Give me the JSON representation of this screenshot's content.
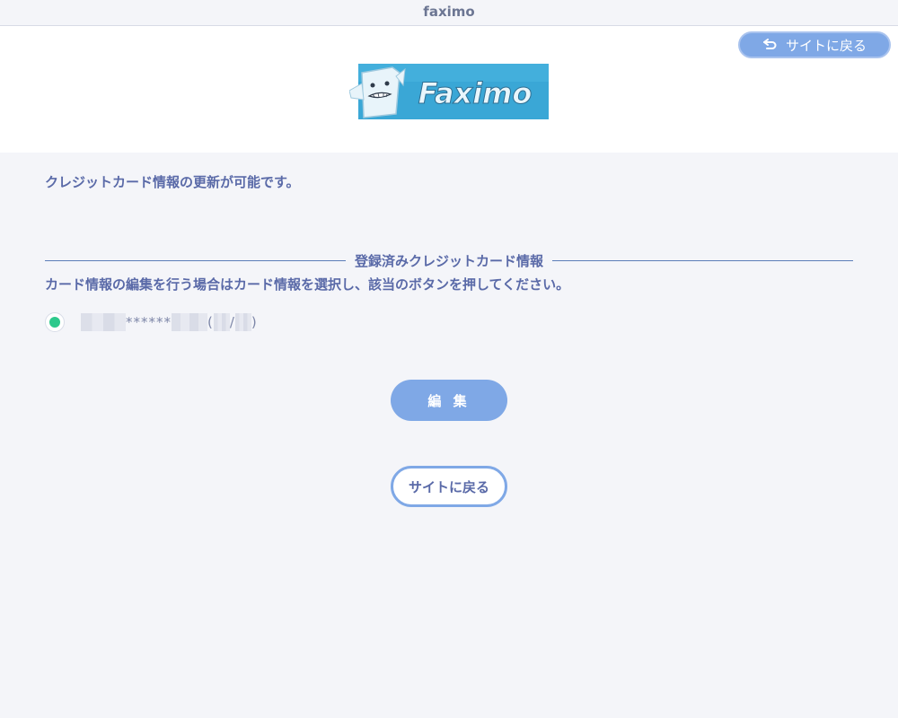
{
  "window": {
    "title": "faximo"
  },
  "header": {
    "back_label": "サイトに戻る",
    "logo_text": "Faximo"
  },
  "main": {
    "intro": "クレジットカード情報の更新が可能です。",
    "section_title": "登録済みクレジットカード情報",
    "instruction": "カード情報の編集を行う場合はカード情報を選択し、該当のボタンを押してください。",
    "card": {
      "selected": true,
      "masked_middle": "******",
      "open_paren": "(",
      "separator": "/",
      "close_paren": ")"
    },
    "edit_label": "編 集",
    "back_label": "サイトに戻る"
  },
  "colors": {
    "accent": "#7fa8e6",
    "text": "#5a6aa8",
    "radio_selected": "#2ec98c",
    "background": "#f4f5f9"
  },
  "icons": {
    "back": "return-arrow-icon",
    "radio": "radio-dot-icon"
  }
}
